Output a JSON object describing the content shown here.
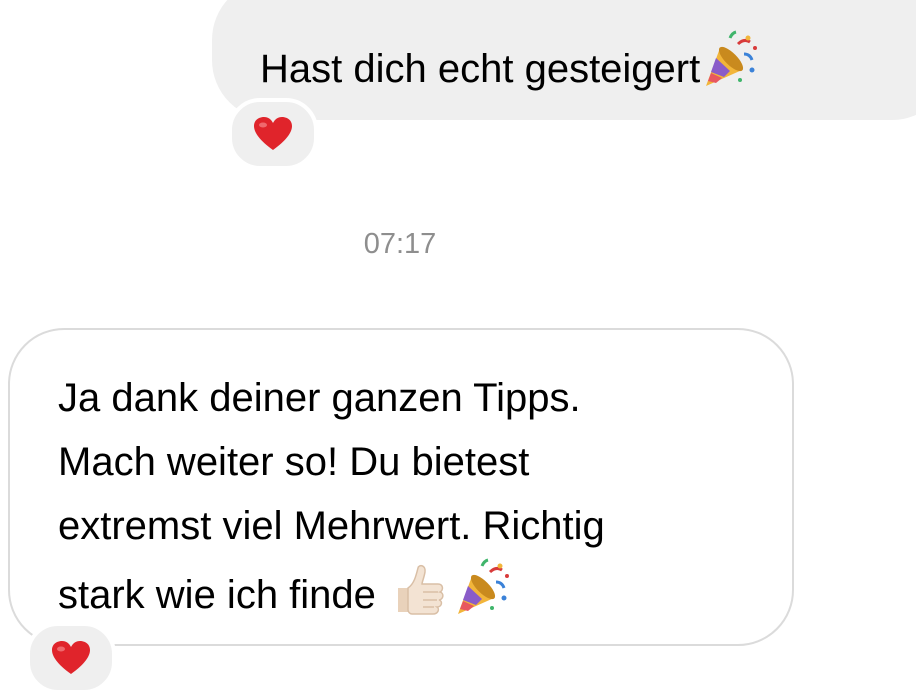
{
  "messages": {
    "outgoing": {
      "text": "Hast dich echt gesteigert",
      "emoji": "party-popper",
      "reaction": "red-heart"
    },
    "timestamp": "07:17",
    "incoming": {
      "lines": [
        "Ja dank deiner ganzen Tipps.",
        "Mach weiter so! Du bietest",
        "extremst viel Mehrwert. Richtig",
        "stark wie ich finde"
      ],
      "emojis": [
        "thumbs-up",
        "party-popper"
      ],
      "reaction": "red-heart"
    }
  },
  "colors": {
    "outgoing_bubble": "#efefef",
    "incoming_border": "#dbdbdb",
    "timestamp": "#8e8e8e",
    "heart": "#e0242b"
  }
}
